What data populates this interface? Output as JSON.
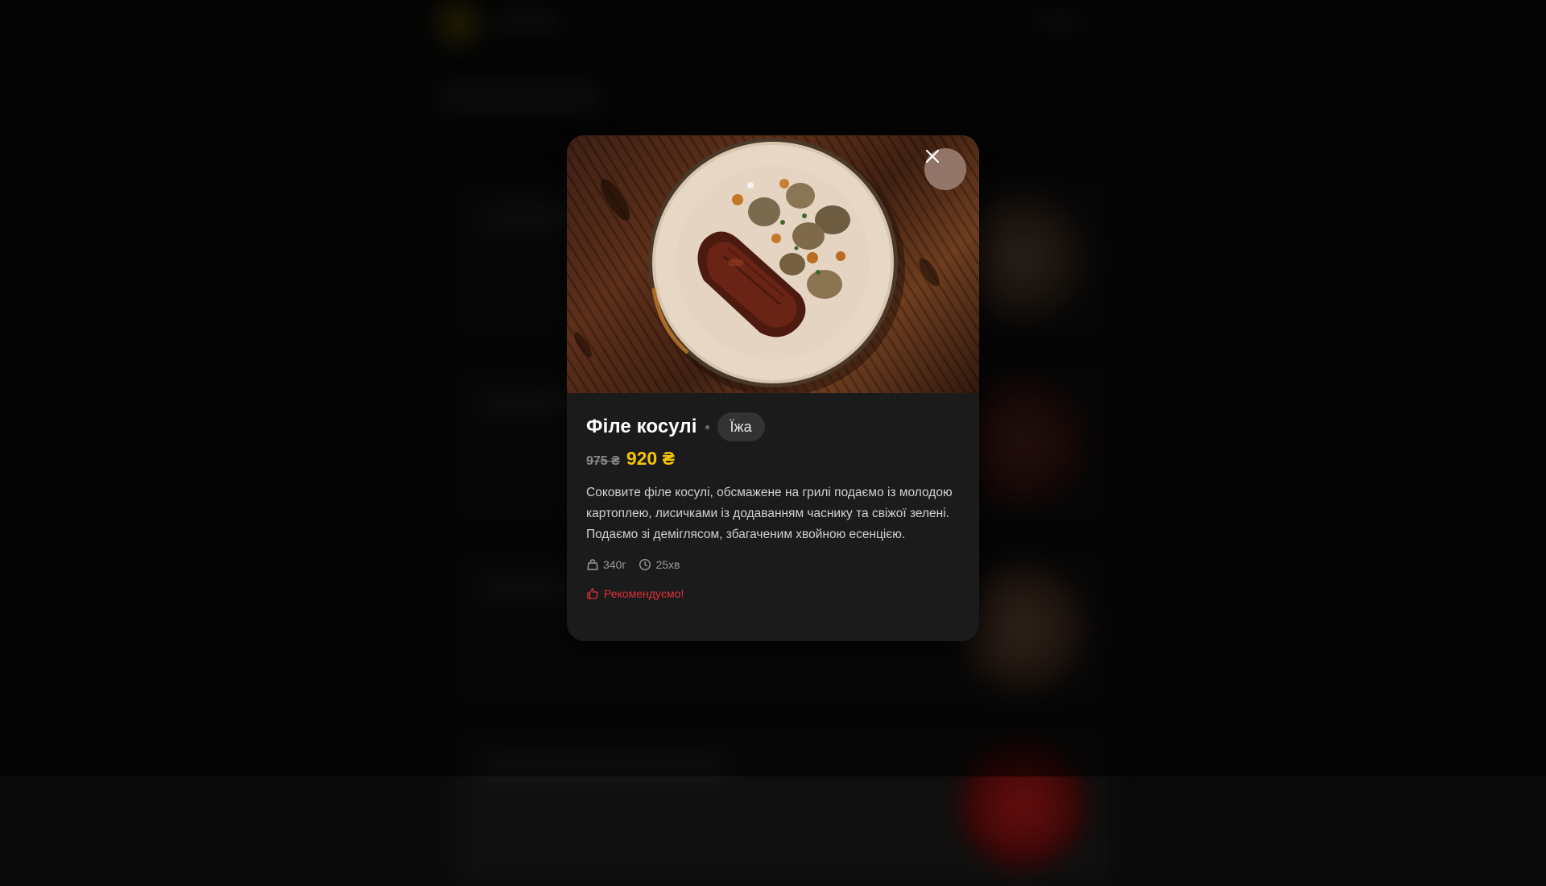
{
  "dish": {
    "title": "Філе косулі",
    "category": "Їжа",
    "old_price": "975 ₴",
    "new_price": "920 ₴",
    "description": "Соковите філе косулі, обсмажене на грилі подаємо із молодою картоплею, лисичками із додаванням часнику та свіжої зелені. Подаємо зі деміглясом, збагаченим хвойною есенцією.",
    "weight": "340г",
    "cook_time": "25хв",
    "recommendation": "Рекомендуємо!",
    "image_icon": "dish-photo",
    "weight_icon": "weight-icon",
    "time_icon": "clock-icon",
    "recommend_icon": "thumbs-up-icon"
  },
  "modal": {
    "close_icon": "close-icon"
  },
  "colors": {
    "modal_bg": "#1b1b1b",
    "accent_price": "#f5c400",
    "recommend": "#e0303a",
    "tag_bg": "#333333"
  }
}
